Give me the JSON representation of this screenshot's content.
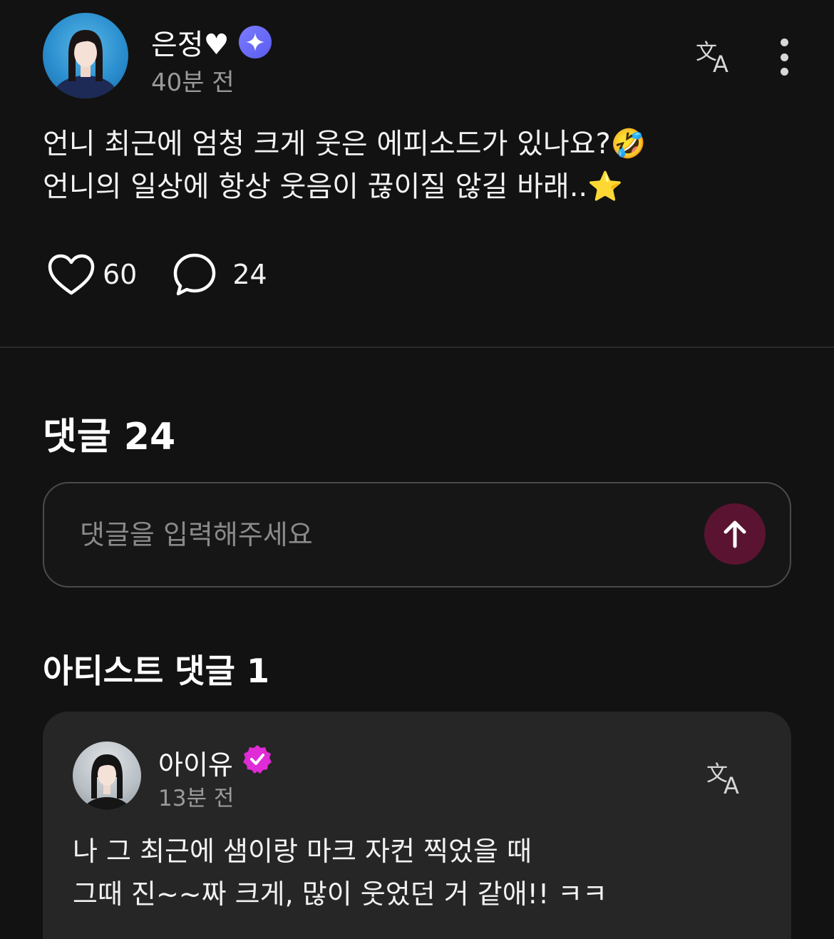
{
  "post": {
    "author": "은정♥",
    "time": "40분 전",
    "lines": [
      "언니 최근에 엄청 크게 웃은 에피소드가 있나요?🤣",
      "언니의 일상에 항상 웃음이 끊이질 않길 바래..⭐"
    ],
    "likes": "60",
    "comments": "24"
  },
  "comments_section": {
    "title": "댓글 24",
    "input_placeholder": "댓글을 입력해주세요"
  },
  "artist_section": {
    "title": "아티스트 댓글 1",
    "comment": {
      "author": "아이유",
      "time": "13분 전",
      "lines": [
        "나 그 최근에 샘이랑 마크 자컨 찍었을 때",
        "그때 진~~짜 크게, 많이 웃었던 거 같애!! ㅋㅋ"
      ]
    }
  },
  "icons": {
    "fan_badge": "sparkle-badge-icon",
    "artist_badge": "verified-badge-icon",
    "translate": "translate-icon",
    "more": "more-vertical-icon",
    "like": "heart-icon",
    "comment": "comment-bubble-icon",
    "send": "arrow-up-icon"
  },
  "colors": {
    "background": "#121212",
    "card": "#262626",
    "fan_badge": "#6b6cf7",
    "artist_badge": "#e02bd6",
    "send_button": "#5a1431"
  }
}
